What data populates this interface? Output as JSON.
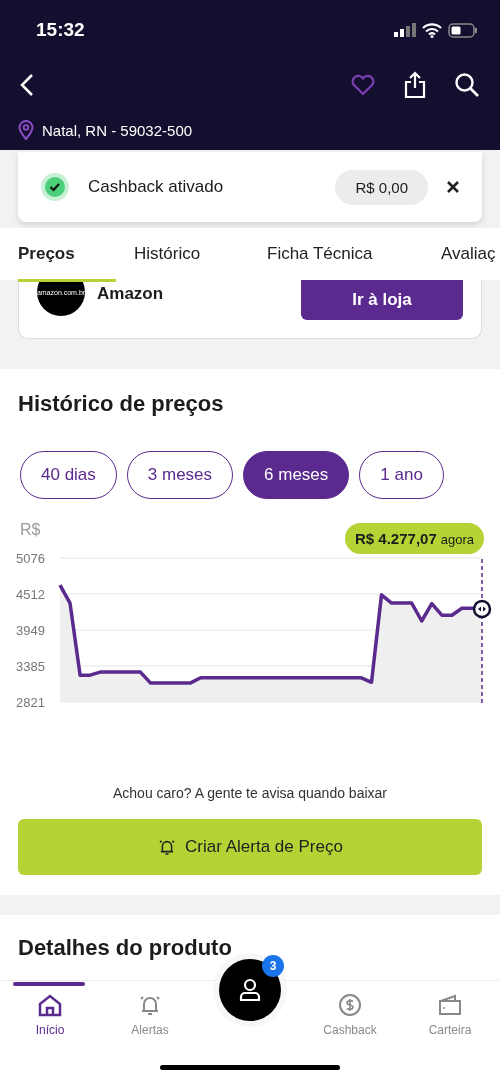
{
  "status_bar": {
    "time": "15:32"
  },
  "location": "Natal, RN - 59032-500",
  "cashback": {
    "label": "Cashback ativado",
    "amount": "R$ 0,00"
  },
  "tabs": [
    {
      "label": "Preços",
      "selected": true
    },
    {
      "label": "Histórico",
      "selected": false
    },
    {
      "label": "Ficha Técnica",
      "selected": false
    },
    {
      "label": "Avaliaç",
      "selected": false
    }
  ],
  "store": {
    "logo_text": "amazon.com.br",
    "name": "Amazon",
    "button": "Ir à loja"
  },
  "price_history": {
    "title": "Histórico de preços",
    "periods": [
      {
        "label": "40 dias",
        "selected": false
      },
      {
        "label": "3 meses",
        "selected": false
      },
      {
        "label": "6 meses",
        "selected": true
      },
      {
        "label": "1 ano",
        "selected": false
      }
    ],
    "tooltip": {
      "price": "R$ 4.277,07",
      "suffix": "agora"
    },
    "chart_data": {
      "type": "area",
      "ylabel": "R$",
      "grid": true,
      "ylim": [
        2821,
        5076
      ],
      "yticks": [
        2821,
        3385,
        3949,
        4512,
        5076
      ],
      "categories": [
        null,
        null,
        null,
        null,
        null,
        null,
        null,
        null,
        null,
        null,
        null,
        null,
        null,
        null,
        null,
        null,
        null,
        null,
        null,
        null,
        null,
        null,
        null,
        null,
        null,
        null,
        null,
        null,
        null,
        null,
        null,
        null,
        null,
        null,
        null,
        null,
        null,
        null,
        null,
        null,
        null,
        null,
        null
      ],
      "series": [
        {
          "color": "#5b2a8e",
          "values": [
            4650,
            4370,
            3240,
            3240,
            3290,
            3290,
            3290,
            3290,
            3290,
            3120,
            3120,
            3120,
            3120,
            3120,
            3200,
            3200,
            3200,
            3200,
            3200,
            3200,
            3200,
            3200,
            3200,
            3200,
            3200,
            3200,
            3200,
            3200,
            3200,
            3200,
            3200,
            3130,
            4500,
            4370,
            4370,
            4370,
            4090,
            4360,
            4180,
            4180,
            4290,
            4290,
            4277
          ]
        }
      ]
    },
    "alert_hint": "Achou caro? A gente te avisa quando baixar",
    "alert_button": "Criar Alerta de Preço"
  },
  "details_title": "Detalhes do produto",
  "bottom_nav": {
    "items": [
      {
        "kind": "home",
        "label": "Início",
        "selected": true
      },
      {
        "kind": "alerts",
        "label": "Alertas",
        "selected": false
      },
      {
        "kind": "profile",
        "badge": "3",
        "selected": false
      },
      {
        "kind": "cashback",
        "label": "Cashback",
        "selected": false
      },
      {
        "kind": "wallet",
        "label": "Carteira",
        "selected": false
      }
    ]
  }
}
